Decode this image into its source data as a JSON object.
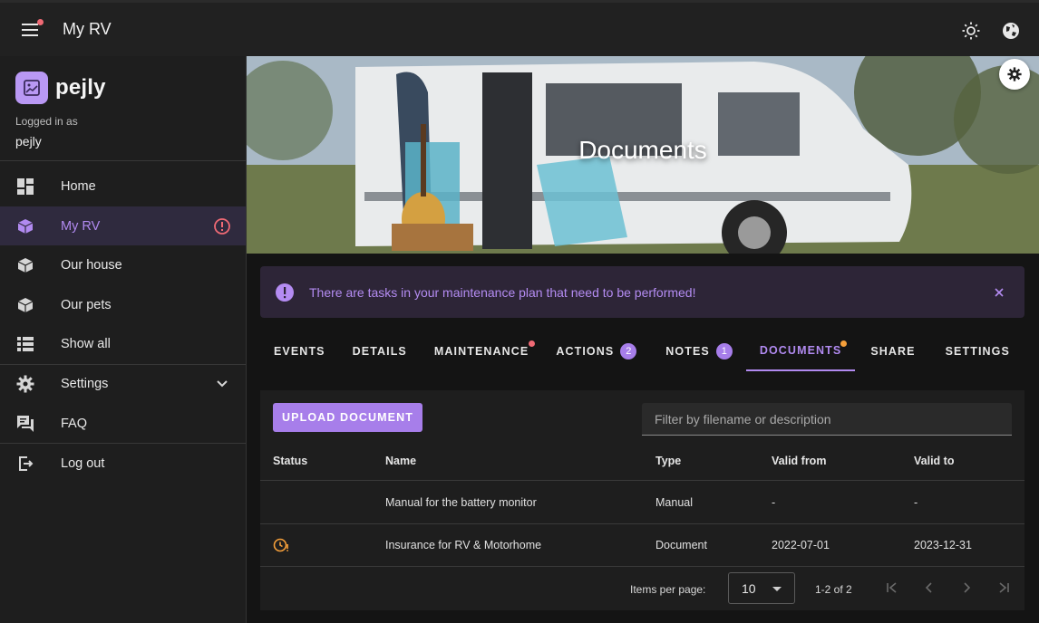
{
  "topbar": {
    "title": "My RV",
    "menu_icon": "menu-icon",
    "theme_icon": "brightness-icon",
    "language_icon": "globe-icon"
  },
  "sidebar": {
    "brand": "pejly",
    "logged_in_label": "Logged in as",
    "user": "pejly",
    "items": [
      {
        "label": "Home",
        "icon": "dashboard-icon"
      },
      {
        "label": "My RV",
        "icon": "cube-icon",
        "active": true,
        "trail_icon": "alert-circle-icon"
      },
      {
        "label": "Our house",
        "icon": "cube-icon"
      },
      {
        "label": "Our pets",
        "icon": "cube-icon"
      },
      {
        "label": "Show all",
        "icon": "list-icon"
      },
      {
        "label": "Settings",
        "icon": "gear-icon",
        "trail_icon": "chevron-down-icon"
      },
      {
        "label": "FAQ",
        "icon": "faq-icon"
      },
      {
        "label": "Log out",
        "icon": "logout-icon"
      }
    ]
  },
  "hero": {
    "title": "Documents"
  },
  "alert": {
    "text": "There are tasks in your maintenance plan that need to be performed!"
  },
  "tabs": [
    {
      "label": "EVENTS"
    },
    {
      "label": "DETAILS"
    },
    {
      "label": "MAINTENANCE",
      "dot": "#f06a75"
    },
    {
      "label": "ACTIONS",
      "badge": "2"
    },
    {
      "label": "NOTES",
      "badge": "1"
    },
    {
      "label": "DOCUMENTS",
      "active": true,
      "dot": "#f59f3a"
    },
    {
      "label": "SHARE"
    },
    {
      "label": "SETTINGS"
    }
  ],
  "documents": {
    "upload_label": "UPLOAD DOCUMENT",
    "filter_placeholder": "Filter by filename or description",
    "columns": [
      "Status",
      "Name",
      "Type",
      "Valid from",
      "Valid to"
    ],
    "rows": [
      {
        "status": "",
        "name": "Manual for the battery monitor",
        "type": "Manual",
        "valid_from": "-",
        "valid_to": "-"
      },
      {
        "status": "clock-alert-icon",
        "name": "Insurance for RV & Motorhome",
        "type": "Document",
        "valid_from": "2022-07-01",
        "valid_to": "2023-12-31"
      }
    ],
    "pager": {
      "items_per_page_label": "Items per page:",
      "items_per_page": "10",
      "range": "1-2 of 2"
    }
  },
  "colors": {
    "accent": "#a77eea",
    "warning": "#f59f3a",
    "notice": "#f06a75"
  }
}
